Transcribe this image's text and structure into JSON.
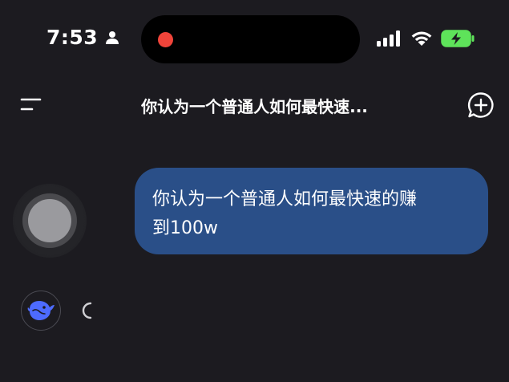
{
  "status_bar": {
    "time": "7:53",
    "icons": [
      "person-icon",
      "cellular-signal-icon",
      "wifi-icon",
      "battery-charging-icon"
    ],
    "colors": {
      "recording": "#f0443a",
      "battery": "#5ee35a"
    }
  },
  "nav": {
    "title": "你认为一个普通人如何最快速...",
    "left_icon": "menu-icon",
    "right_icon": "new-chat-icon"
  },
  "chat": {
    "messages": [
      {
        "role": "user",
        "text_line_1": "你认为一个普通人如何最快速的赚",
        "text_line_2": "到100w"
      }
    ],
    "assistant_status": "loading-spinner-icon",
    "assistant_avatar": "whale-logo-icon",
    "bubble_color": "#2a4f88",
    "logo_color": "#4d6bfe"
  }
}
